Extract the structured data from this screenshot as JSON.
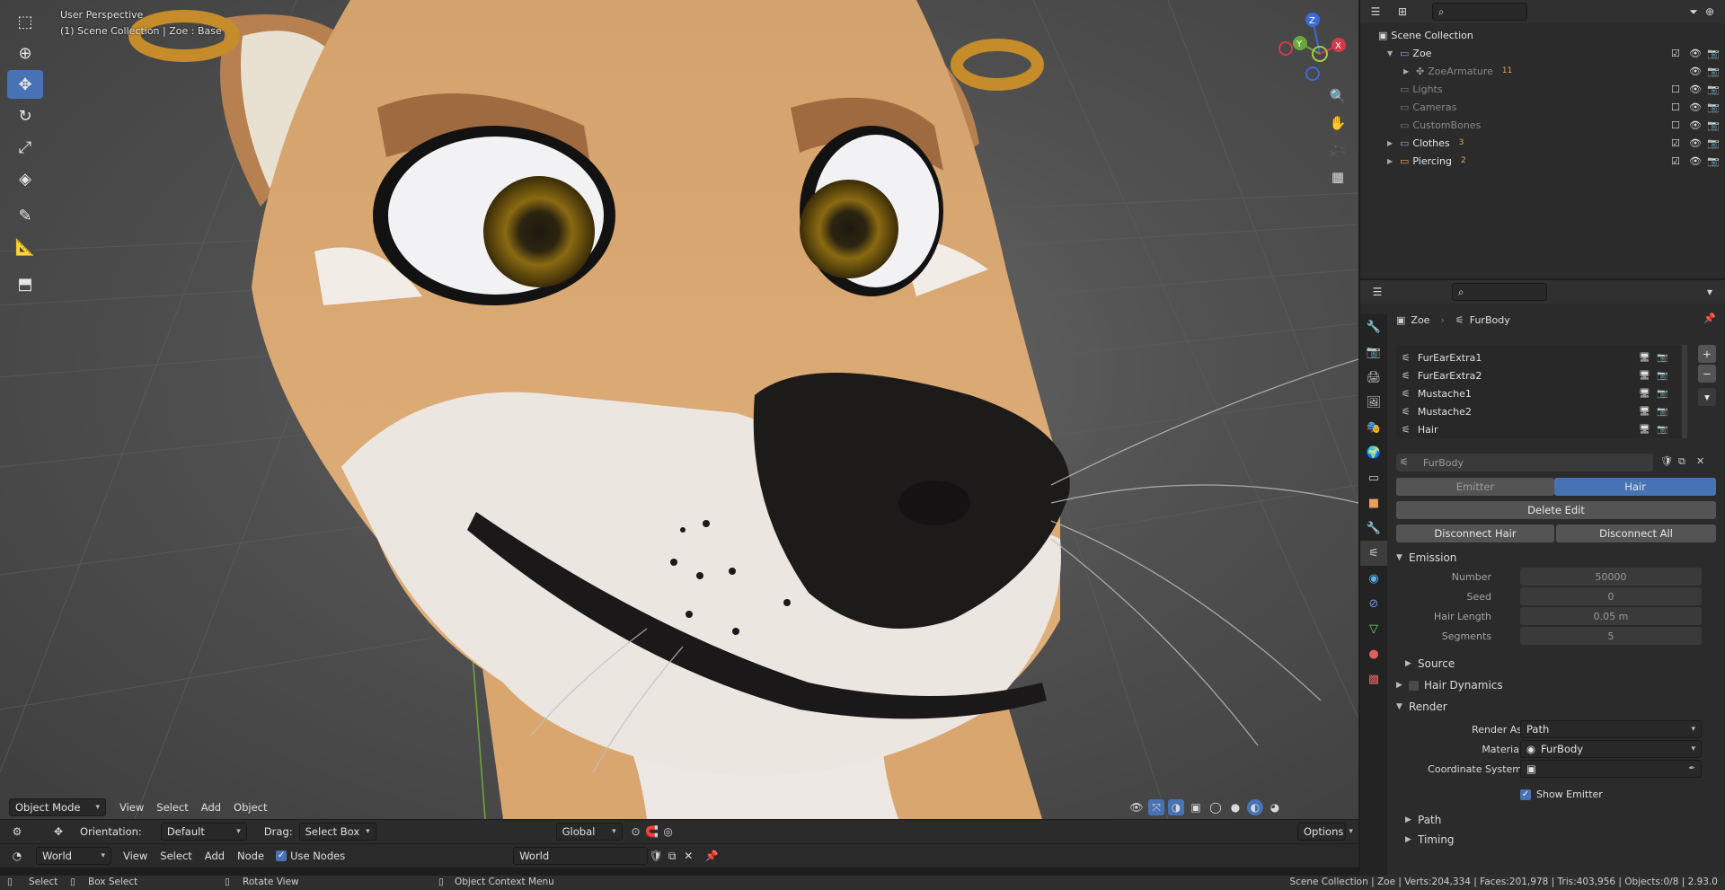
{
  "viewport": {
    "perspective": "User Perspective",
    "context": "(1) Scene Collection | Zoe : Base",
    "mode": "Object Mode",
    "menus": [
      "View",
      "Select",
      "Add",
      "Object"
    ]
  },
  "tool_settings": {
    "orientation_label": "Orientation:",
    "orientation_value": "Default",
    "drag_label": "Drag:",
    "drag_value": "Select Box",
    "transform_value": "Global",
    "options": "Options"
  },
  "node_editor": {
    "world_type": "World",
    "menus": [
      "View",
      "Select",
      "Add",
      "Node"
    ],
    "use_nodes": "Use Nodes",
    "world_name": "World"
  },
  "gizmo": {
    "z": "Z",
    "y": "Y",
    "x": "X"
  },
  "outliner": {
    "title": "Scene Collection",
    "rows": [
      {
        "label": "Zoe",
        "color": "#b38bd6",
        "icon": "collection-icon"
      },
      {
        "label": "ZoeArmature",
        "color": "#8a8a8a",
        "icon": "armature-icon",
        "extra": "11"
      },
      {
        "label": "Lights",
        "color": "#777777",
        "icon": "collection-icon"
      },
      {
        "label": "Cameras",
        "color": "#777777",
        "icon": "collection-icon"
      },
      {
        "label": "CustomBones",
        "color": "#777777",
        "icon": "collection-icon"
      },
      {
        "label": "Clothes",
        "color": "#b38bd6",
        "icon": "collection-icon",
        "extra": "3"
      },
      {
        "label": "Piercing",
        "color": "#e8a05a",
        "icon": "collection-icon",
        "extra": "2"
      }
    ]
  },
  "properties": {
    "breadcrumb_object": "Zoe",
    "breadcrumb_system": "FurBody",
    "particle_systems": [
      "FurEarExtra1",
      "FurEarExtra2",
      "Mustache1",
      "Mustache2",
      "Hair"
    ],
    "settings_name": "FurBody",
    "type_tabs": [
      "Emitter",
      "Hair"
    ],
    "delete_edit": "Delete Edit",
    "disconnect_hair": "Disconnect Hair",
    "disconnect_all": "Disconnect All",
    "emission": {
      "title": "Emission",
      "number_label": "Number",
      "number": "50000",
      "seed_label": "Seed",
      "seed": "0",
      "length_label": "Hair Length",
      "length": "0.05 m",
      "segments_label": "Segments",
      "segments": "5"
    },
    "source": "Source",
    "hair_dynamics": "Hair Dynamics",
    "render": {
      "title": "Render",
      "render_as_label": "Render As",
      "render_as": "Path",
      "material_label": "Material",
      "material": "FurBody",
      "coord_label": "Coordinate System",
      "show_emitter": "Show Emitter"
    },
    "path": "Path",
    "timing": "Timing"
  },
  "statusbar": {
    "select": "Select",
    "box_select": "Box Select",
    "rotate_view": "Rotate View",
    "context_menu": "Object Context Menu",
    "stats": "Scene Collection | Zoe | Verts:204,334 | Faces:201,978 | Tris:403,956 | Objects:0/8 | 2.93.0"
  },
  "colors": {
    "accent": "#4772b3",
    "fur": "#d9a46b",
    "nose": "#1d1b1a",
    "eye_iris": "#8a6a12"
  }
}
